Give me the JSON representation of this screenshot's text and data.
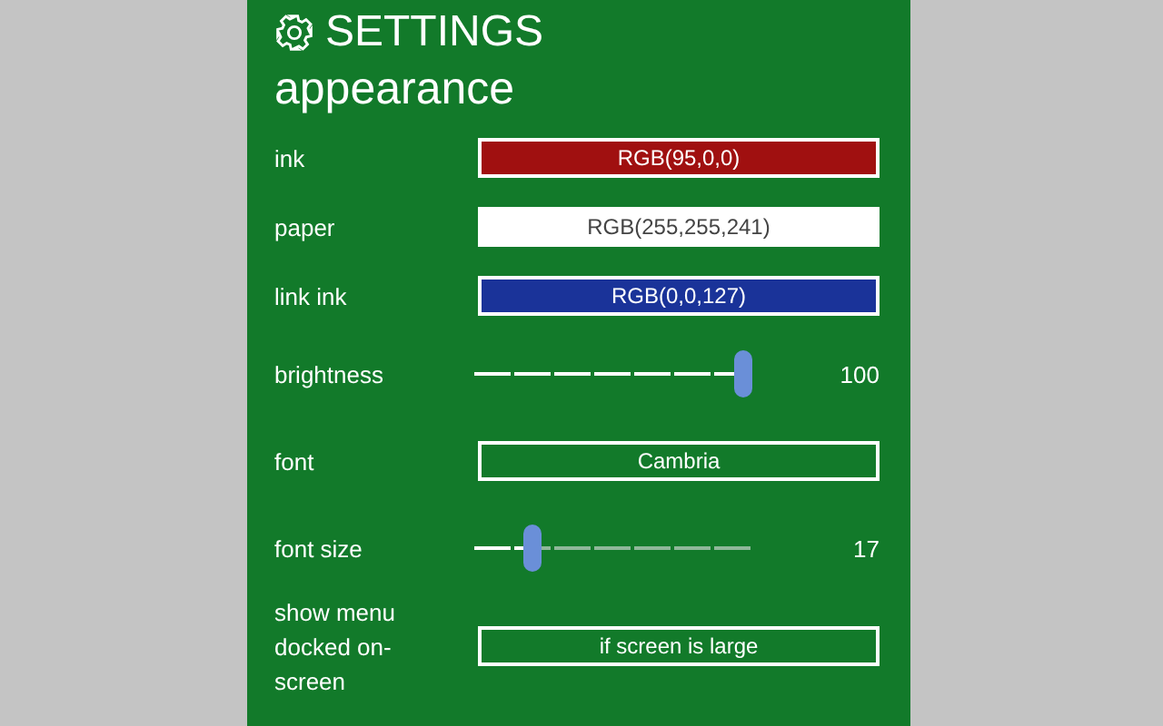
{
  "header": {
    "title": "SETTINGS",
    "subtitle": "appearance"
  },
  "settings": [
    {
      "kind": "color",
      "label": "ink",
      "value": "RGB(95,0,0)",
      "color": "#a01010"
    },
    {
      "kind": "color",
      "label": "paper",
      "value": "RGB(255,255,241)",
      "color": "#ffffff"
    },
    {
      "kind": "color",
      "label": "link ink",
      "value": "RGB(0,0,127)",
      "color": "#1a3399"
    },
    {
      "kind": "slider",
      "label": "brightness",
      "level": 1.0,
      "reading": "100"
    },
    {
      "kind": "select",
      "label": "font",
      "value": "Cambria"
    },
    {
      "kind": "slider",
      "label": "font size",
      "level": 0.19,
      "reading": "17"
    },
    {
      "kind": "select",
      "label": "show menu docked on-screen",
      "value": "if screen is large"
    }
  ]
}
